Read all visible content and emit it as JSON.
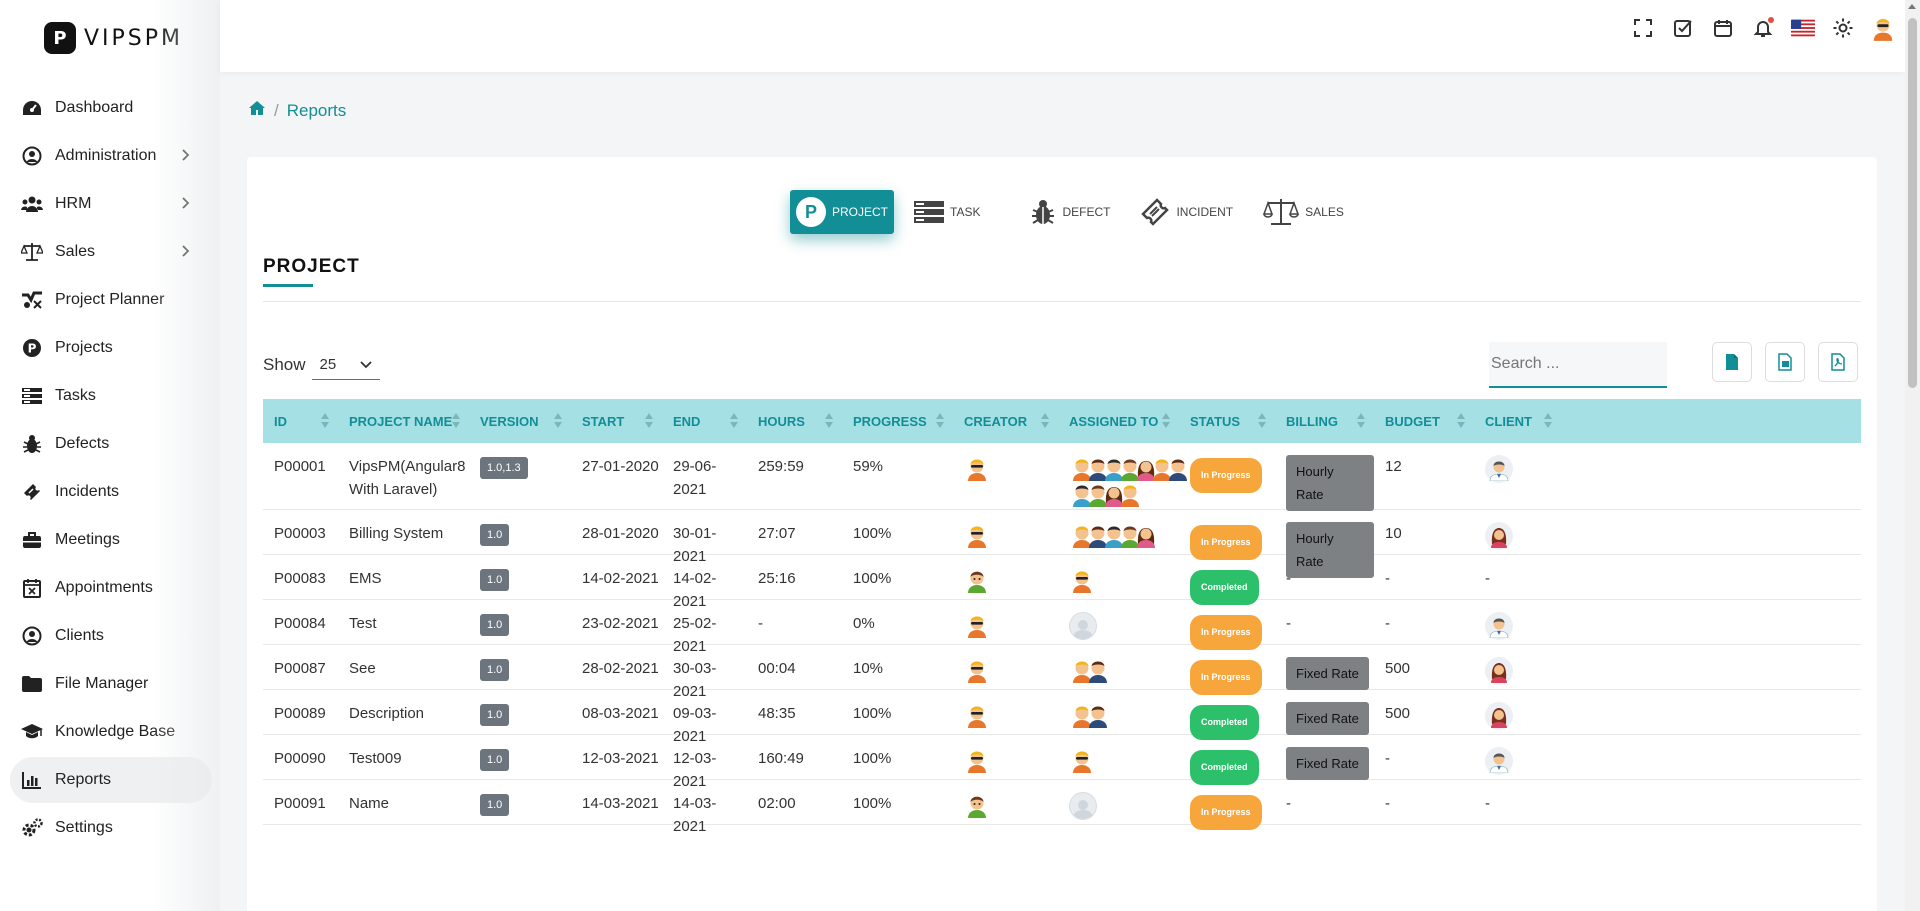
{
  "brand": {
    "name": "VIPSPM"
  },
  "sidebar": {
    "items": [
      {
        "label": "Dashboard",
        "icon": "dashboard-icon",
        "has_children": false
      },
      {
        "label": "Administration",
        "icon": "user-icon",
        "has_children": true
      },
      {
        "label": "HRM",
        "icon": "users-icon",
        "has_children": true
      },
      {
        "label": "Sales",
        "icon": "scale-icon",
        "has_children": true
      },
      {
        "label": "Project Planner",
        "icon": "planner-icon",
        "has_children": false
      },
      {
        "label": "Projects",
        "icon": "p-circle-icon",
        "has_children": false
      },
      {
        "label": "Tasks",
        "icon": "tasks-icon",
        "has_children": false
      },
      {
        "label": "Defects",
        "icon": "bug-icon",
        "has_children": false
      },
      {
        "label": "Incidents",
        "icon": "ticket-icon",
        "has_children": false
      },
      {
        "label": "Meetings",
        "icon": "briefcase-icon",
        "has_children": false
      },
      {
        "label": "Appointments",
        "icon": "calendar-x-icon",
        "has_children": false
      },
      {
        "label": "Clients",
        "icon": "user-icon",
        "has_children": false
      },
      {
        "label": "File Manager",
        "icon": "folder-icon",
        "has_children": false
      },
      {
        "label": "Knowledge Base",
        "icon": "graduation-cap-icon",
        "has_children": false
      },
      {
        "label": "Reports",
        "icon": "bar-chart-icon",
        "has_children": false,
        "active": true
      },
      {
        "label": "Settings",
        "icon": "cogs-icon",
        "has_children": false
      }
    ]
  },
  "header": {
    "icons": [
      "fullscreen-icon",
      "checkbox-icon",
      "calendar-icon",
      "bell-icon",
      "us-flag-icon",
      "gear-icon",
      "user-avatar"
    ]
  },
  "breadcrumb": {
    "home_icon": "home-icon",
    "current": "Reports"
  },
  "report_tabs": [
    {
      "label": "PROJECT",
      "icon": "p-circle-icon",
      "active": true
    },
    {
      "label": "TASK",
      "icon": "server-icon"
    },
    {
      "label": "DEFECT",
      "icon": "bug-icon"
    },
    {
      "label": "INCIDENT",
      "icon": "ticket-icon"
    },
    {
      "label": "SALES",
      "icon": "scale-icon"
    }
  ],
  "section": {
    "title": "PROJECT"
  },
  "controls": {
    "show_label": "Show",
    "page_size": "25",
    "search_placeholder": "Search ...",
    "export_buttons": [
      "export-csv-icon",
      "export-excel-icon",
      "export-pdf-icon"
    ]
  },
  "table": {
    "columns": [
      "ID",
      "PROJECT NAME",
      "VERSION",
      "START",
      "END",
      "HOURS",
      "PROGRESS",
      "CREATOR",
      "ASSIGNED TO",
      "STATUS",
      "BILLING",
      "BUDGET",
      "CLIENT"
    ],
    "rows": [
      {
        "id": "P00001",
        "name": "VipsPM(Angular8 With Laravel)",
        "version": "1.0,1.3",
        "start": "27-01-2020",
        "end": "29-06-2021",
        "hours": "259:59",
        "progress": "59%",
        "creator": "glasses",
        "assigned": 11,
        "status": "In Progress",
        "billing": "Hourly Rate",
        "budget": "12",
        "client": "doctor"
      },
      {
        "id": "P00003",
        "name": "Billing System",
        "version": "1.0",
        "start": "28-01-2020",
        "end": "30-01-2021",
        "hours": "27:07",
        "progress": "100%",
        "creator": "glasses",
        "assigned": 5,
        "status": "In Progress",
        "billing": "Hourly Rate",
        "budget": "10",
        "client": "woman"
      },
      {
        "id": "P00083",
        "name": "EMS",
        "version": "1.0",
        "start": "14-02-2021",
        "end": "14-02-2021",
        "hours": "25:16",
        "progress": "100%",
        "creator": "green",
        "assigned": 1,
        "status": "Completed",
        "billing": "-",
        "budget": "-",
        "client": "-"
      },
      {
        "id": "P00084",
        "name": "Test",
        "version": "1.0",
        "start": "23-02-2021",
        "end": "25-02-2021",
        "hours": "-",
        "progress": "0%",
        "creator": "glasses",
        "assigned": 0,
        "status": "In Progress",
        "billing": "-",
        "budget": "-",
        "client": "doctor"
      },
      {
        "id": "P00087",
        "name": "See",
        "version": "1.0",
        "start": "28-02-2021",
        "end": "30-03-2021",
        "hours": "00:04",
        "progress": "10%",
        "creator": "glasses",
        "assigned": 2,
        "status": "In Progress",
        "billing": "Fixed Rate",
        "budget": "500",
        "client": "woman"
      },
      {
        "id": "P00089",
        "name": "Description",
        "version": "1.0",
        "start": "08-03-2021",
        "end": "09-03-2021",
        "hours": "48:35",
        "progress": "100%",
        "creator": "glasses",
        "assigned": 2,
        "status": "Completed",
        "billing": "Fixed Rate",
        "budget": "500",
        "client": "woman"
      },
      {
        "id": "P00090",
        "name": "Test009",
        "version": "1.0",
        "start": "12-03-2021",
        "end": "12-03-2021",
        "hours": "160:49",
        "progress": "100%",
        "creator": "glasses",
        "assigned": 1,
        "status": "Completed",
        "billing": "Fixed Rate",
        "budget": "-",
        "client": "doctor"
      },
      {
        "id": "P00091",
        "name": "Name",
        "version": "1.0",
        "start": "14-03-2021",
        "end": "14-03-2021",
        "hours": "02:00",
        "progress": "100%",
        "creator": "green",
        "assigned": 0,
        "status": "In Progress",
        "billing": "-",
        "budget": "-",
        "client": "-"
      }
    ]
  },
  "colors": {
    "accent": "#128e96",
    "table_head": "#a5e0e5",
    "in_progress": "#f7a63b",
    "completed": "#2cc06b"
  }
}
